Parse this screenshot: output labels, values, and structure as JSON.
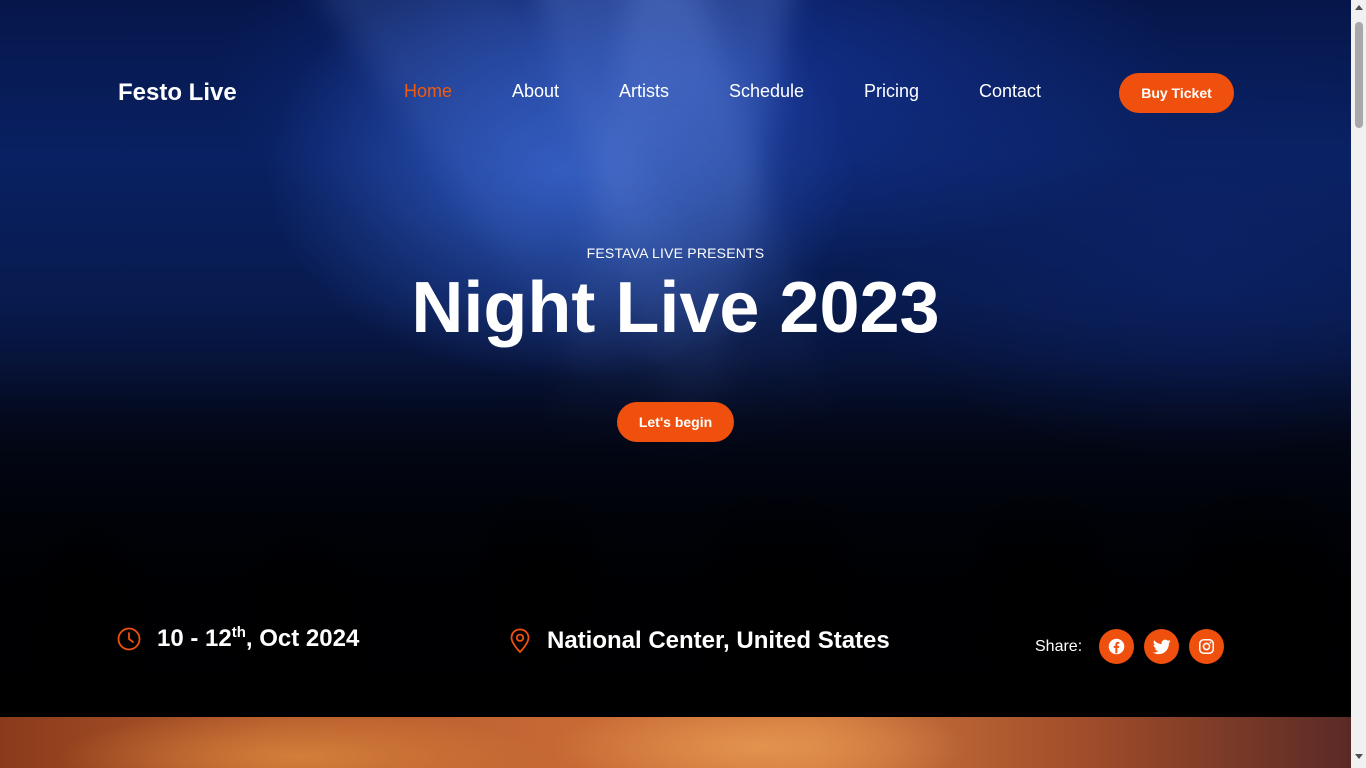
{
  "header": {
    "brand": "Festo Live",
    "nav": {
      "home": "Home",
      "about": "About",
      "artists": "Artists",
      "schedule": "Schedule",
      "pricing": "Pricing",
      "contact": "Contact"
    },
    "active_item": "Home",
    "buy_ticket": "Buy Ticket"
  },
  "hero": {
    "presents": "FESTAVA LIVE PRESENTS",
    "title": "Night Live 2023",
    "cta": "Let's begin"
  },
  "info": {
    "date_prefix": "10 - 12",
    "date_sup": "th",
    "date_suffix": ", Oct 2024",
    "location": "National Center, United States",
    "share_label": "Share:",
    "social_icons": [
      "facebook-icon",
      "twitter-icon",
      "instagram-icon"
    ]
  },
  "colors": {
    "accent": "#f0500d",
    "text": "#ffffff",
    "hero_blue": "#0b2670"
  }
}
